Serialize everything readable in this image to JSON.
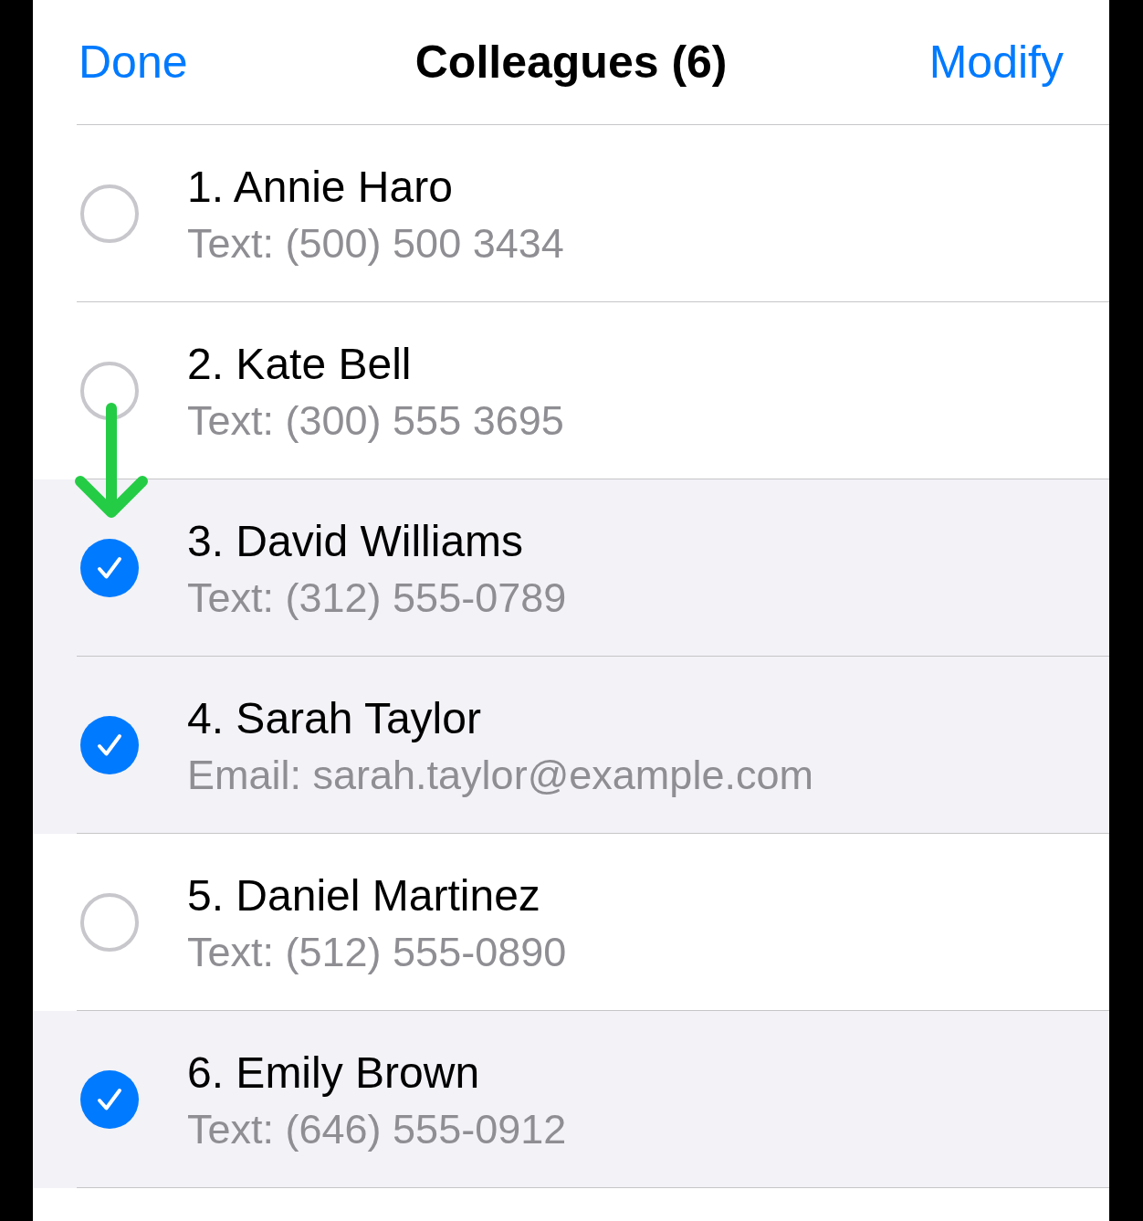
{
  "header": {
    "left_button": "Done",
    "title": "Colleagues (6)",
    "right_button": "Modify"
  },
  "contacts": [
    {
      "name": "1. Annie Haro",
      "detail": "Text: (500) 500 3434",
      "selected": false,
      "arrow_marker": false
    },
    {
      "name": "2. Kate Bell",
      "detail": "Text: (300) 555 3695",
      "selected": false,
      "arrow_marker": false
    },
    {
      "name": "3. David Williams",
      "detail": "Text: (312) 555-0789",
      "selected": true,
      "arrow_marker": true
    },
    {
      "name": "4. Sarah Taylor",
      "detail": "Email: sarah.taylor@example.com",
      "selected": true,
      "arrow_marker": false
    },
    {
      "name": "5. Daniel Martinez",
      "detail": "Text: (512) 555-0890",
      "selected": false,
      "arrow_marker": false
    },
    {
      "name": "6. Emily Brown",
      "detail": "Text: (646) 555-0912",
      "selected": true,
      "arrow_marker": false
    }
  ]
}
